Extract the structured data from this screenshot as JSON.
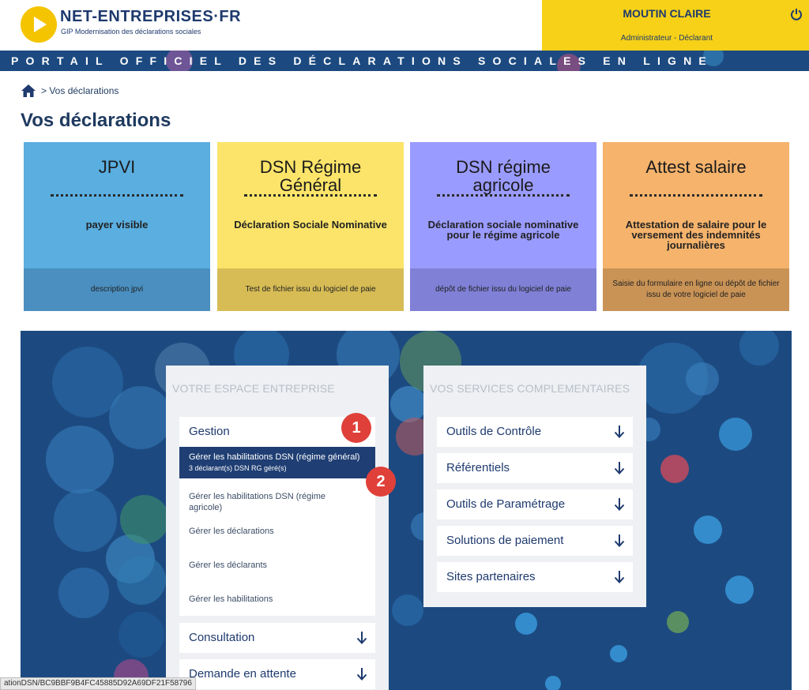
{
  "header": {
    "brand_name": "NET-ENTREPRISES·FR",
    "brand_subtitle": "GIP Modernisation des déclarations sociales",
    "user_name": "MOUTIN CLAIRE",
    "user_role": "Administrateur - Déclarant",
    "banner": "PORTAIL OFFICIEL DES DÉCLARATIONS SOCIALES EN LIGNE"
  },
  "breadcrumb": {
    "current": "> Vos déclarations"
  },
  "page_title": "Vos déclarations",
  "cards": [
    {
      "title": "JPVI",
      "desc": "payer visible",
      "foot": "description jpvi",
      "color": "#5aaee0",
      "foot_color": "#4a8fc0"
    },
    {
      "title": "DSN Régime Général",
      "desc": "Déclaration Sociale Nominative",
      "foot": "Test de fichier issu du logiciel de paie",
      "color": "#fbe469",
      "foot_color": "#d7bc55"
    },
    {
      "title": "DSN régime agricole",
      "desc": "Déclaration sociale nominative pour le régime agricole",
      "foot": "dépôt de fichier issu du logiciel de paie",
      "color": "#9a9bff",
      "foot_color": "#7f80d6"
    },
    {
      "title": "Attest salaire",
      "desc": "Attestation de salaire pour le versement des indemnités journalières",
      "foot": "Saisie du formulaire en ligne ou dépôt de fichier issu de votre logiciel de paie",
      "color": "#f5b36c",
      "foot_color": "#c99356"
    }
  ],
  "espace": {
    "title": "VOTRE ESPACE ENTREPRISE",
    "gestion": "Gestion",
    "sub_items": [
      {
        "line1": "Gérer les habilitations DSN (régime général)",
        "line2": "3 déclarant(s) DSN RG géré(s)"
      },
      {
        "line1": "Gérer les habilitations DSN (régime",
        "line2": "agricole)"
      },
      {
        "line1": "Gérer les déclarations",
        "line2": ""
      },
      {
        "line1": "Gérer les déclarants",
        "line2": ""
      },
      {
        "line1": "Gérer les habilitations",
        "line2": ""
      }
    ],
    "consultation": "Consultation",
    "demande": "Demande en attente"
  },
  "services": {
    "title": "VOS SERVICES COMPLEMENTAIRES",
    "items": [
      "Outils de Contrôle",
      "Référentiels",
      "Outils de Paramétrage",
      "Solutions de paiement",
      "Sites partenaires"
    ]
  },
  "badges": [
    "1",
    "2"
  ],
  "status_bar": "ationDSN/BC9BBF9B4FC45885D92A69DF21F58796",
  "colors": {
    "navy": "#1c4a80",
    "yellow": "#f7d117",
    "accent_red": "#e0403a"
  }
}
